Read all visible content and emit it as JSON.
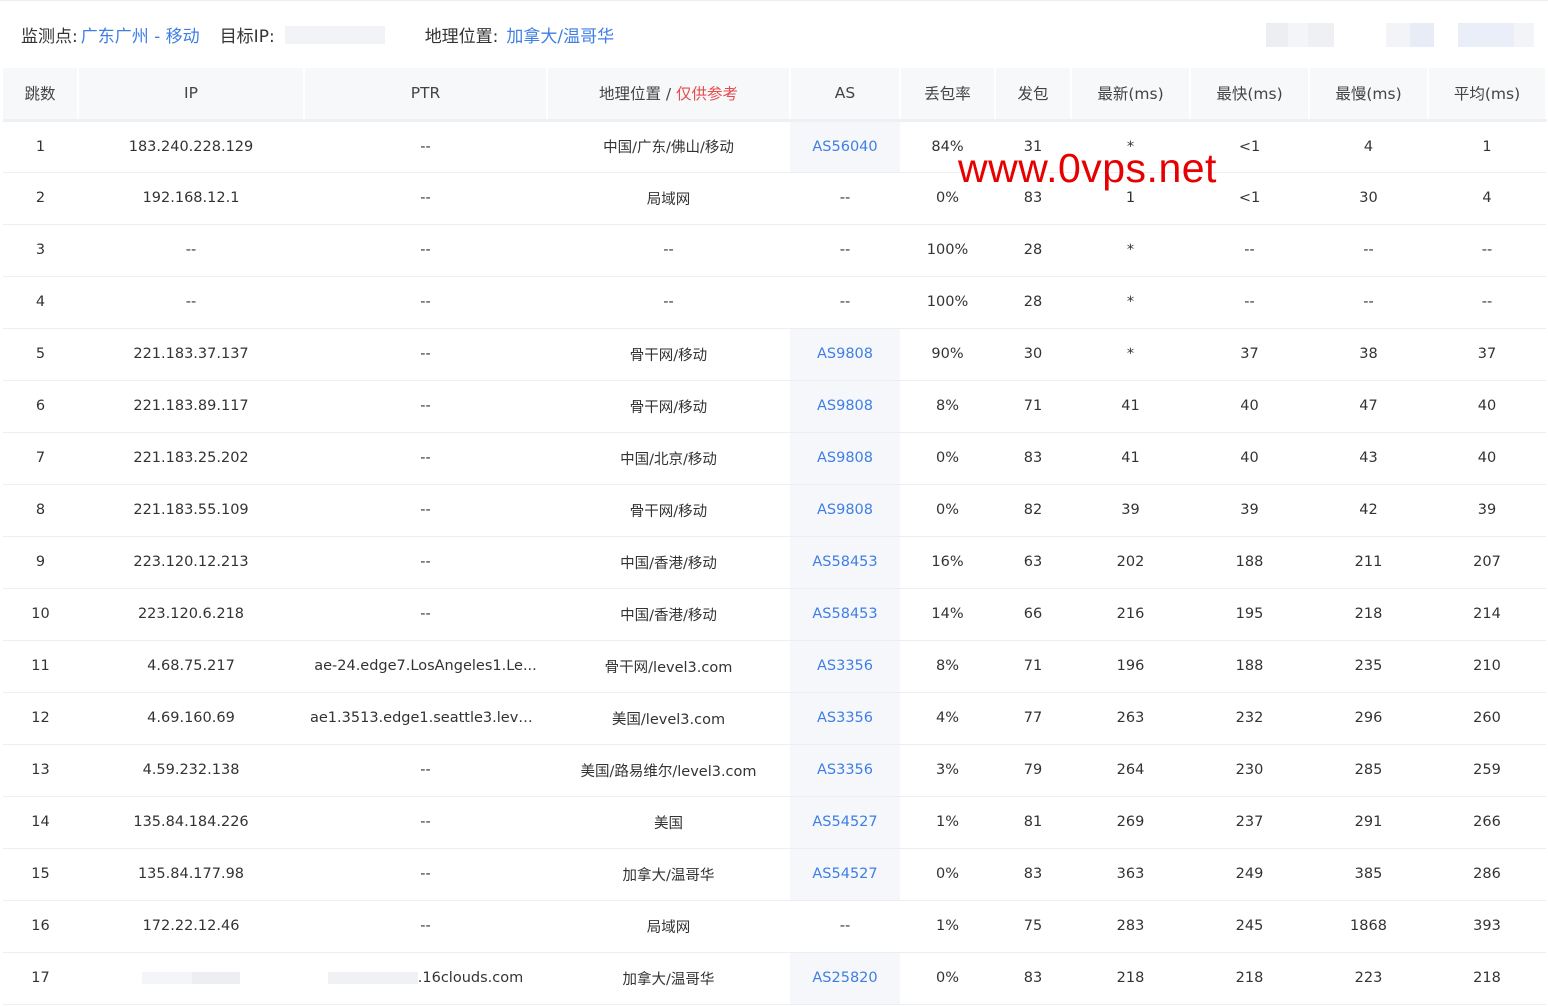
{
  "header": {
    "monitor_label": "监测点:",
    "monitor_value": "广东广州 - 移动",
    "target_label": "目标IP:",
    "geo_label": "地理位置:",
    "geo_value": "加拿大/温哥华"
  },
  "table": {
    "columns": {
      "hop": "跳数",
      "ip": "IP",
      "ptr": "PTR",
      "geo": "地理位置",
      "geo_sep": " / ",
      "geo_hint": "仅供参考",
      "as": "AS",
      "loss": "丢包率",
      "sent": "发包",
      "last": "最新(ms)",
      "best": "最快(ms)",
      "worst": "最慢(ms)",
      "avg": "平均(ms)"
    },
    "rows": [
      {
        "hop": "1",
        "ip": "183.240.228.129",
        "ptr": "--",
        "geo": "中国/广东/佛山/移动",
        "as": "AS56040",
        "loss": "84%",
        "sent": "31",
        "last": "*",
        "best": "<1",
        "worst": "4",
        "avg": "1"
      },
      {
        "hop": "2",
        "ip": "192.168.12.1",
        "ptr": "--",
        "geo": "局域网",
        "as": "--",
        "loss": "0%",
        "sent": "83",
        "last": "1",
        "best": "<1",
        "worst": "30",
        "avg": "4"
      },
      {
        "hop": "3",
        "ip": "--",
        "ptr": "--",
        "geo": "--",
        "as": "--",
        "loss": "100%",
        "sent": "28",
        "last": "*",
        "best": "--",
        "worst": "--",
        "avg": "--"
      },
      {
        "hop": "4",
        "ip": "--",
        "ptr": "--",
        "geo": "--",
        "as": "--",
        "loss": "100%",
        "sent": "28",
        "last": "*",
        "best": "--",
        "worst": "--",
        "avg": "--"
      },
      {
        "hop": "5",
        "ip": "221.183.37.137",
        "ptr": "--",
        "geo": "骨干网/移动",
        "as": "AS9808",
        "loss": "90%",
        "sent": "30",
        "last": "*",
        "best": "37",
        "worst": "38",
        "avg": "37"
      },
      {
        "hop": "6",
        "ip": "221.183.89.117",
        "ptr": "--",
        "geo": "骨干网/移动",
        "as": "AS9808",
        "loss": "8%",
        "sent": "71",
        "last": "41",
        "best": "40",
        "worst": "47",
        "avg": "40"
      },
      {
        "hop": "7",
        "ip": "221.183.25.202",
        "ptr": "--",
        "geo": "中国/北京/移动",
        "as": "AS9808",
        "loss": "0%",
        "sent": "83",
        "last": "41",
        "best": "40",
        "worst": "43",
        "avg": "40"
      },
      {
        "hop": "8",
        "ip": "221.183.55.109",
        "ptr": "--",
        "geo": "骨干网/移动",
        "as": "AS9808",
        "loss": "0%",
        "sent": "82",
        "last": "39",
        "best": "39",
        "worst": "42",
        "avg": "39"
      },
      {
        "hop": "9",
        "ip": "223.120.12.213",
        "ptr": "--",
        "geo": "中国/香港/移动",
        "as": "AS58453",
        "loss": "16%",
        "sent": "63",
        "last": "202",
        "best": "188",
        "worst": "211",
        "avg": "207"
      },
      {
        "hop": "10",
        "ip": "223.120.6.218",
        "ptr": "--",
        "geo": "中国/香港/移动",
        "as": "AS58453",
        "loss": "14%",
        "sent": "66",
        "last": "216",
        "best": "195",
        "worst": "218",
        "avg": "214"
      },
      {
        "hop": "11",
        "ip": "4.68.75.217",
        "ptr": "ae-24.edge7.LosAngeles1.Le...",
        "geo": "骨干网/level3.com",
        "as": "AS3356",
        "loss": "8%",
        "sent": "71",
        "last": "196",
        "best": "188",
        "worst": "235",
        "avg": "210"
      },
      {
        "hop": "12",
        "ip": "4.69.160.69",
        "ptr": "ae1.3513.edge1.seattle3.leve...",
        "geo": "美国/level3.com",
        "as": "AS3356",
        "loss": "4%",
        "sent": "77",
        "last": "263",
        "best": "232",
        "worst": "296",
        "avg": "260"
      },
      {
        "hop": "13",
        "ip": "4.59.232.138",
        "ptr": "--",
        "geo": "美国/路易维尔/level3.com",
        "as": "AS3356",
        "loss": "3%",
        "sent": "79",
        "last": "264",
        "best": "230",
        "worst": "285",
        "avg": "259"
      },
      {
        "hop": "14",
        "ip": "135.84.184.226",
        "ptr": "--",
        "geo": "美国",
        "as": "AS54527",
        "loss": "1%",
        "sent": "81",
        "last": "269",
        "best": "237",
        "worst": "291",
        "avg": "266"
      },
      {
        "hop": "15",
        "ip": "135.84.177.98",
        "ptr": "--",
        "geo": "加拿大/温哥华",
        "as": "AS54527",
        "loss": "0%",
        "sent": "83",
        "last": "363",
        "best": "249",
        "worst": "385",
        "avg": "286"
      },
      {
        "hop": "16",
        "ip": "172.22.12.46",
        "ptr": "--",
        "geo": "局域网",
        "as": "--",
        "loss": "1%",
        "sent": "75",
        "last": "283",
        "best": "245",
        "worst": "1868",
        "avg": "393"
      },
      {
        "hop": "17",
        "ip": "",
        "ptr": ".16clouds.com",
        "geo": "加拿大/温哥华",
        "as": "AS25820",
        "loss": "0%",
        "sent": "83",
        "last": "218",
        "best": "218",
        "worst": "223",
        "avg": "218"
      }
    ]
  },
  "watermark": "www.0vps.net",
  "colors": {
    "link": "#3f7fe4",
    "hint": "#e64c4c",
    "watermark": "#e60000",
    "header_bg": "#f7f8fa"
  }
}
